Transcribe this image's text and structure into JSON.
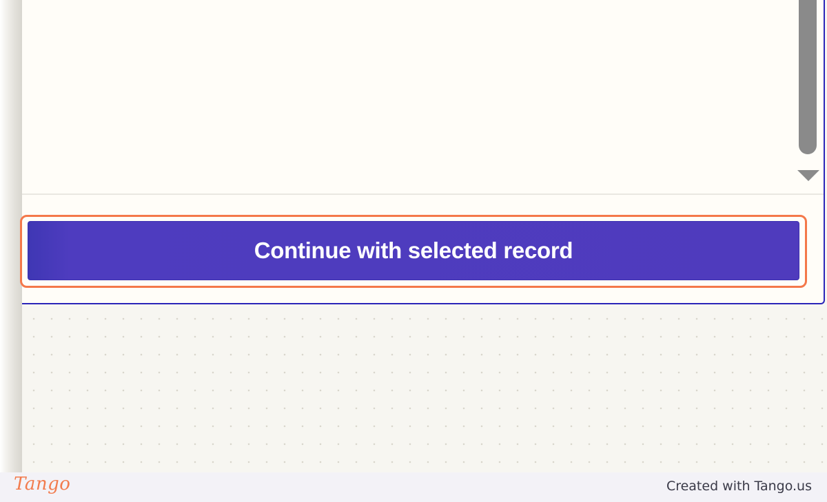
{
  "dialog": {
    "continue_button_label": "Continue with selected record"
  },
  "footer": {
    "brand": "Tango",
    "credit_text": "Created with Tango.us"
  },
  "colors": {
    "button_bg": "#4f3bbd",
    "highlight": "#f4784a",
    "card_border": "#2a24b8",
    "brand_orange": "#f27b4d"
  },
  "icons": {
    "scroll_down": "triangle-down-icon"
  }
}
